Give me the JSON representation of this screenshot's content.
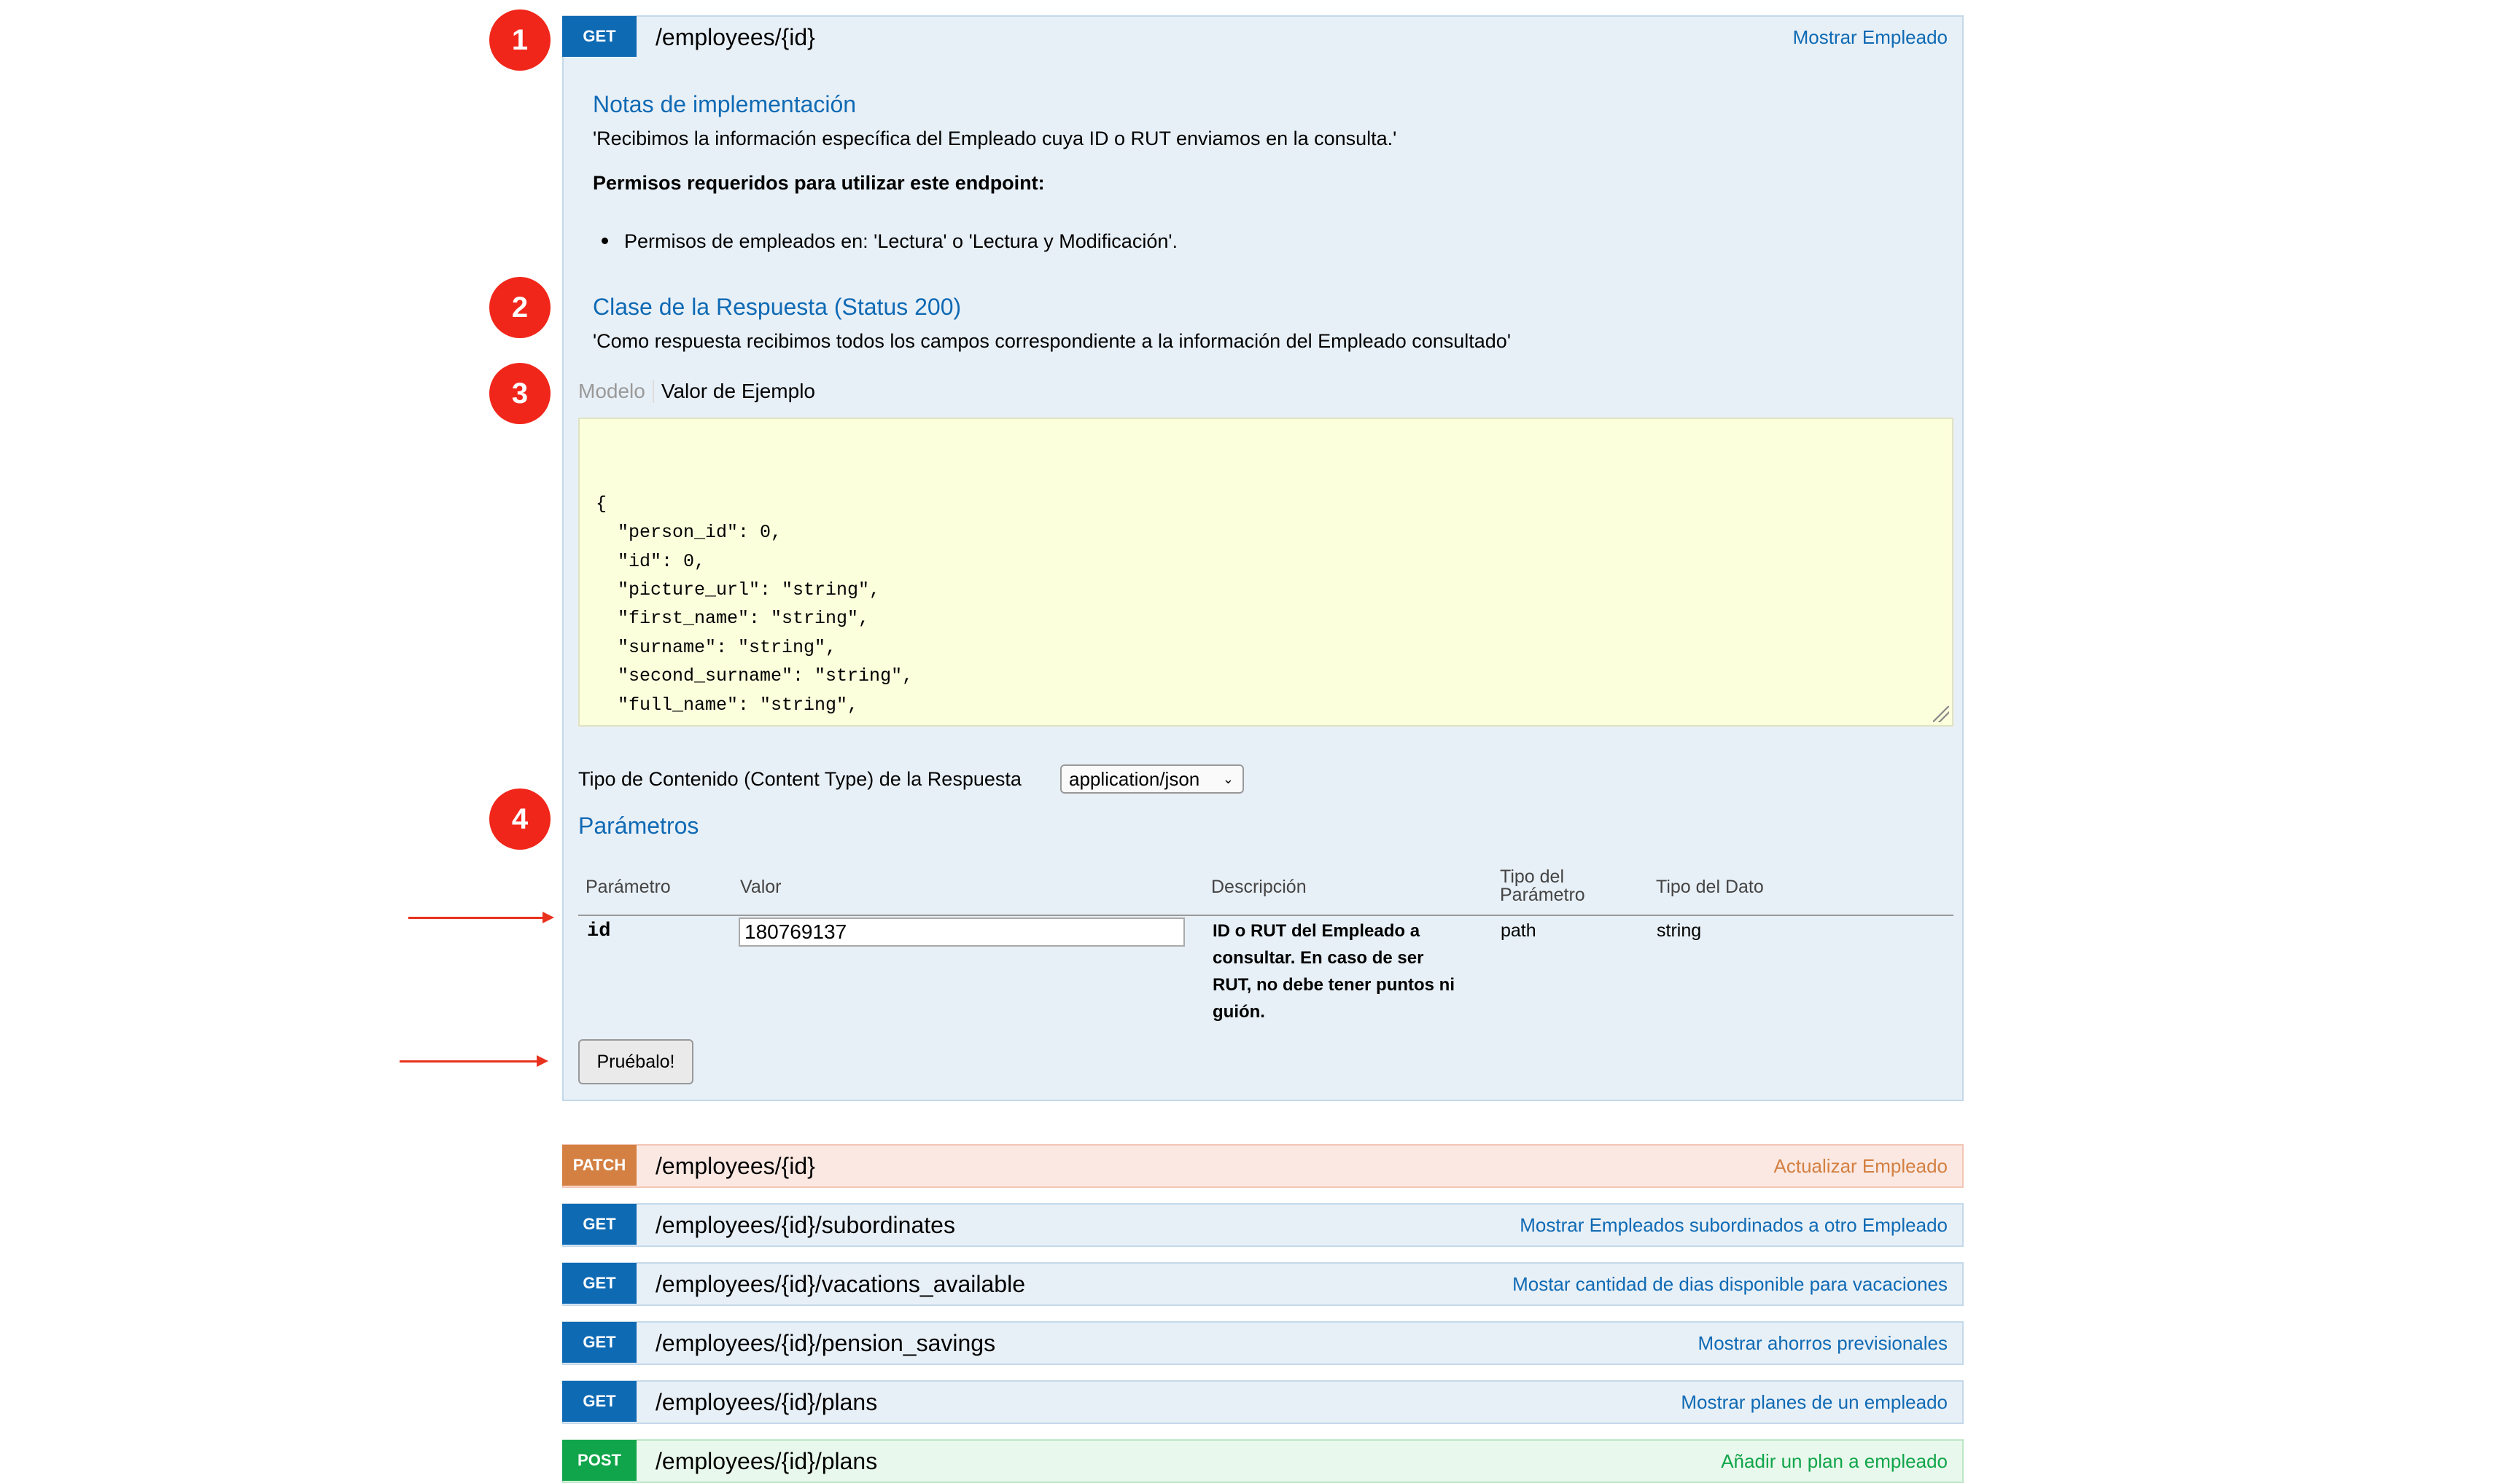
{
  "annotations": [
    "1",
    "2",
    "3",
    "4"
  ],
  "main_operation": {
    "method": "GET",
    "path": "/employees/{id}",
    "summary": "Mostrar Empleado",
    "impl_notes_title": "Notas de implementación",
    "impl_notes_text": "'Recibimos la información específica del Empleado cuya ID o RUT enviamos en la consulta.'",
    "permissions_title": "Permisos requeridos para utilizar este endpoint:",
    "permissions_item": "Permisos de empleados en: 'Lectura' o 'Lectura y Modificación'.",
    "response_class_title": "Clase de la Respuesta (Status 200)",
    "response_class_text": "'Como respuesta recibimos todos los campos correspondiente a la información del Empleado consultado'",
    "tab_model": "Modelo",
    "tab_example": "Valor de Ejemplo",
    "example_json": "{\n  \"person_id\": 0,\n  \"id\": 0,\n  \"picture_url\": \"string\",\n  \"first_name\": \"string\",\n  \"surname\": \"string\",\n  \"second_surname\": \"string\",\n  \"full_name\": \"string\",\n  \"rut\": \"string\",\n  \"nationality\": \"string\",",
    "content_type_label": "Tipo de Contenido (Content Type) de la Respuesta",
    "content_type_value": "application/json",
    "params_title": "Parámetros",
    "params_headers": {
      "param": "Parámetro",
      "value": "Valor",
      "description": "Descripción",
      "param_type_1": "Tipo del",
      "param_type_2": "Parámetro",
      "data_type": "Tipo del Dato"
    },
    "param_row": {
      "name": "id",
      "value": "180769137",
      "description_lines": [
        "ID o RUT del Empleado a",
        "consultar. En caso de ser",
        "RUT, no debe tener puntos ni",
        "guión."
      ],
      "param_type": "path",
      "data_type": "string"
    },
    "try_button": "Pruébalo!"
  },
  "operations": [
    {
      "method": "PATCH",
      "path": "/employees/{id}",
      "summary": "Actualizar Empleado"
    },
    {
      "method": "GET",
      "path": "/employees/{id}/subordinates",
      "summary": "Mostrar Empleados subordinados a otro Empleado"
    },
    {
      "method": "GET",
      "path": "/employees/{id}/vacations_available",
      "summary": "Mostar cantidad de dias disponible para vacaciones"
    },
    {
      "method": "GET",
      "path": "/employees/{id}/pension_savings",
      "summary": "Mostrar ahorros previsionales"
    },
    {
      "method": "GET",
      "path": "/employees/{id}/plans",
      "summary": "Mostrar planes de un empleado"
    },
    {
      "method": "POST",
      "path": "/employees/{id}/plans",
      "summary": "Añadir un plan a empleado"
    }
  ],
  "colors": {
    "get": "#0f6ab4",
    "patch": "#d38042",
    "post": "#10a54a",
    "annotation": "#f1261a",
    "code_bg": "#fcffdc"
  }
}
